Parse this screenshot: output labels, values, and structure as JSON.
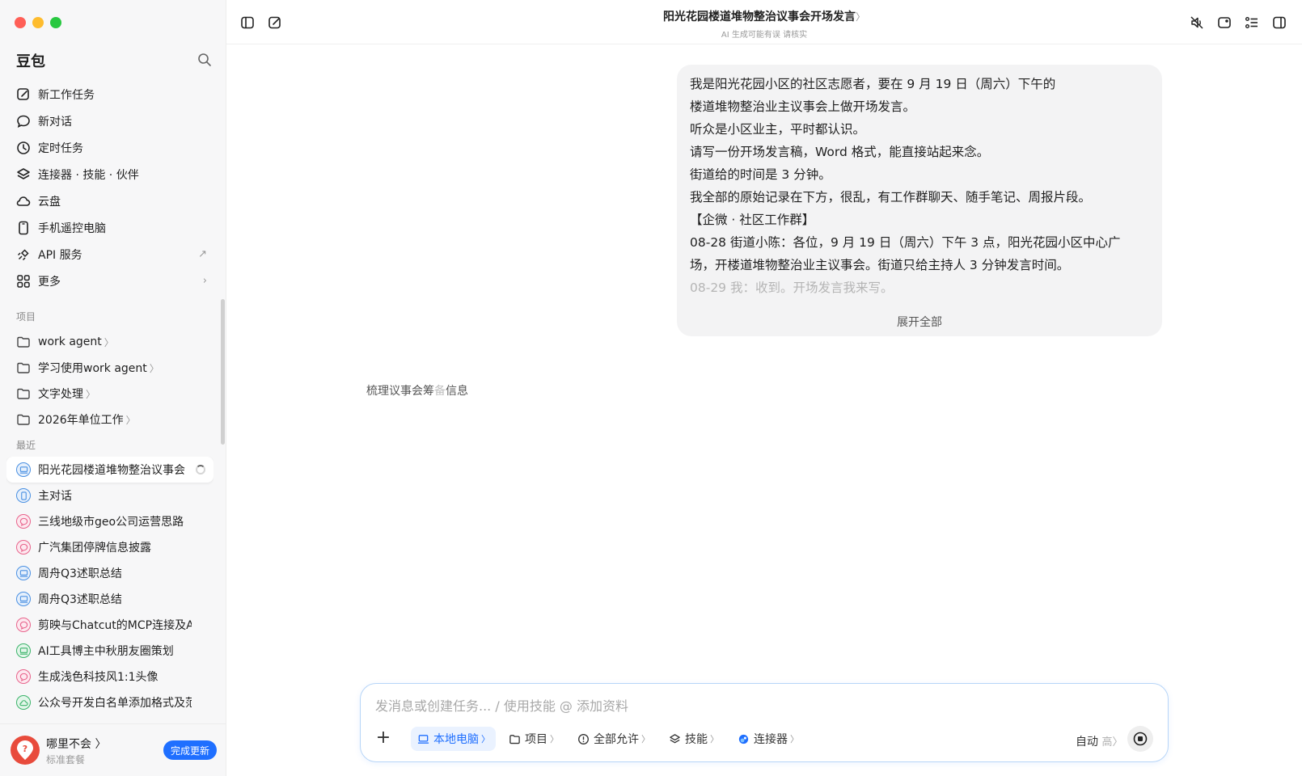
{
  "app": {
    "name": "豆包"
  },
  "sidebar": {
    "nav": [
      {
        "label": "新工作任务",
        "icon": "edit-icon"
      },
      {
        "label": "新对话",
        "icon": "chat-bubble-icon"
      },
      {
        "label": "定时任务",
        "icon": "clock-icon"
      },
      {
        "label": "连接器 · 技能 · 伙伴",
        "icon": "layers-icon"
      },
      {
        "label": "云盘",
        "icon": "cloud-icon"
      },
      {
        "label": "手机遥控电脑",
        "icon": "phone-icon"
      },
      {
        "label": "API 服务",
        "icon": "api-link-icon",
        "trail": "↗"
      },
      {
        "label": "更多",
        "icon": "grid-icon",
        "trail": "›"
      }
    ],
    "projects_label": "项目",
    "projects": [
      {
        "label": "work agent"
      },
      {
        "label": "学习使用work agent"
      },
      {
        "label": "文字处理"
      },
      {
        "label": "2026年单位工作"
      }
    ],
    "recent_label": "最近",
    "recent": [
      {
        "label": "阳光花园楼道堆物整治议事会",
        "type": "computer",
        "color": "#4a90e2",
        "bg": "#e6f0fc"
      },
      {
        "label": "主对话",
        "type": "phone",
        "color": "#4a90e2",
        "bg": "#e6f0fc"
      },
      {
        "label": "三线地级市geo公司运营思路",
        "type": "chat",
        "color": "#e8648c",
        "bg": "#fde8ef"
      },
      {
        "label": "广汽集团停牌信息披露",
        "type": "chat",
        "color": "#e8648c",
        "bg": "#fde8ef"
      },
      {
        "label": "周舟Q3述职总结",
        "type": "computer",
        "color": "#4a90e2",
        "bg": "#e6f0fc"
      },
      {
        "label": "周舟Q3述职总结",
        "type": "computer",
        "color": "#4a90e2",
        "bg": "#e6f0fc"
      },
      {
        "label": "剪映与Chatcut的MCP连接及Ag",
        "type": "chat",
        "color": "#e8648c",
        "bg": "#fde8ef"
      },
      {
        "label": "AI工具博主中秋朋友圈策划",
        "type": "computer",
        "color": "#3bb36a",
        "bg": "#e3f6ea"
      },
      {
        "label": "生成浅色科技风1:1头像",
        "type": "chat",
        "color": "#e8648c",
        "bg": "#fde8ef"
      },
      {
        "label": "公众号开发白名单添加格式及范",
        "type": "cloud",
        "color": "#3bb36a",
        "bg": "#e3f6ea"
      }
    ],
    "user": {
      "name": "哪里不会 〉",
      "plan": "标准套餐",
      "update_label": "完成更新"
    }
  },
  "conversation": {
    "title": "阳光花园楼道堆物整治议事会开场发言",
    "title_chevron": "〉",
    "disclaimer": "AI 生成可能有误 请核实",
    "user_message_lines": [
      "我是阳光花园小区的社区志愿者，要在 9 月 19 日（周六）下午的",
      "楼道堆物整治业主议事会上做开场发言。",
      "听众是小区业主，平时都认识。",
      "请写一份开场发言稿，Word 格式，能直接站起来念。",
      "街道给的时间是 3 分钟。",
      "我全部的原始记录在下方，很乱，有工作群聊天、随手笔记、周报片段。",
      "【企微 · 社区工作群】",
      "08-28 街道小陈：各位，9 月 19 日（周六）下午 3 点，阳光花园小区中心广",
      "场，开楼道堆物整治业主议事会。街道只给主持人 3 分钟发言时间。",
      "08-29 我：收到。开场发言我来写。"
    ],
    "expand_label": "展开全部",
    "status_main": "梳理议事会筹",
    "status_dim": "备",
    "status_tail": "信息"
  },
  "composer": {
    "placeholder": "发消息或创建任务... / 使用技能 @ 添加资料",
    "chips": [
      {
        "label": "本地电脑",
        "icon": "laptop-icon",
        "active": true
      },
      {
        "label": "项目",
        "icon": "folder-icon",
        "active": false
      },
      {
        "label": "全部允许",
        "icon": "alert-circle-icon",
        "active": false
      },
      {
        "label": "技能",
        "icon": "layers-icon",
        "active": false
      },
      {
        "label": "连接器",
        "icon": "connector-icon",
        "active": false
      }
    ],
    "mode_label": "自动",
    "mode_level": "高",
    "chip_chevron": "〉"
  },
  "colors": {
    "accent": "#1f6fff",
    "bubble": "#f3f3f4",
    "sidebar": "#f7f7f8"
  }
}
